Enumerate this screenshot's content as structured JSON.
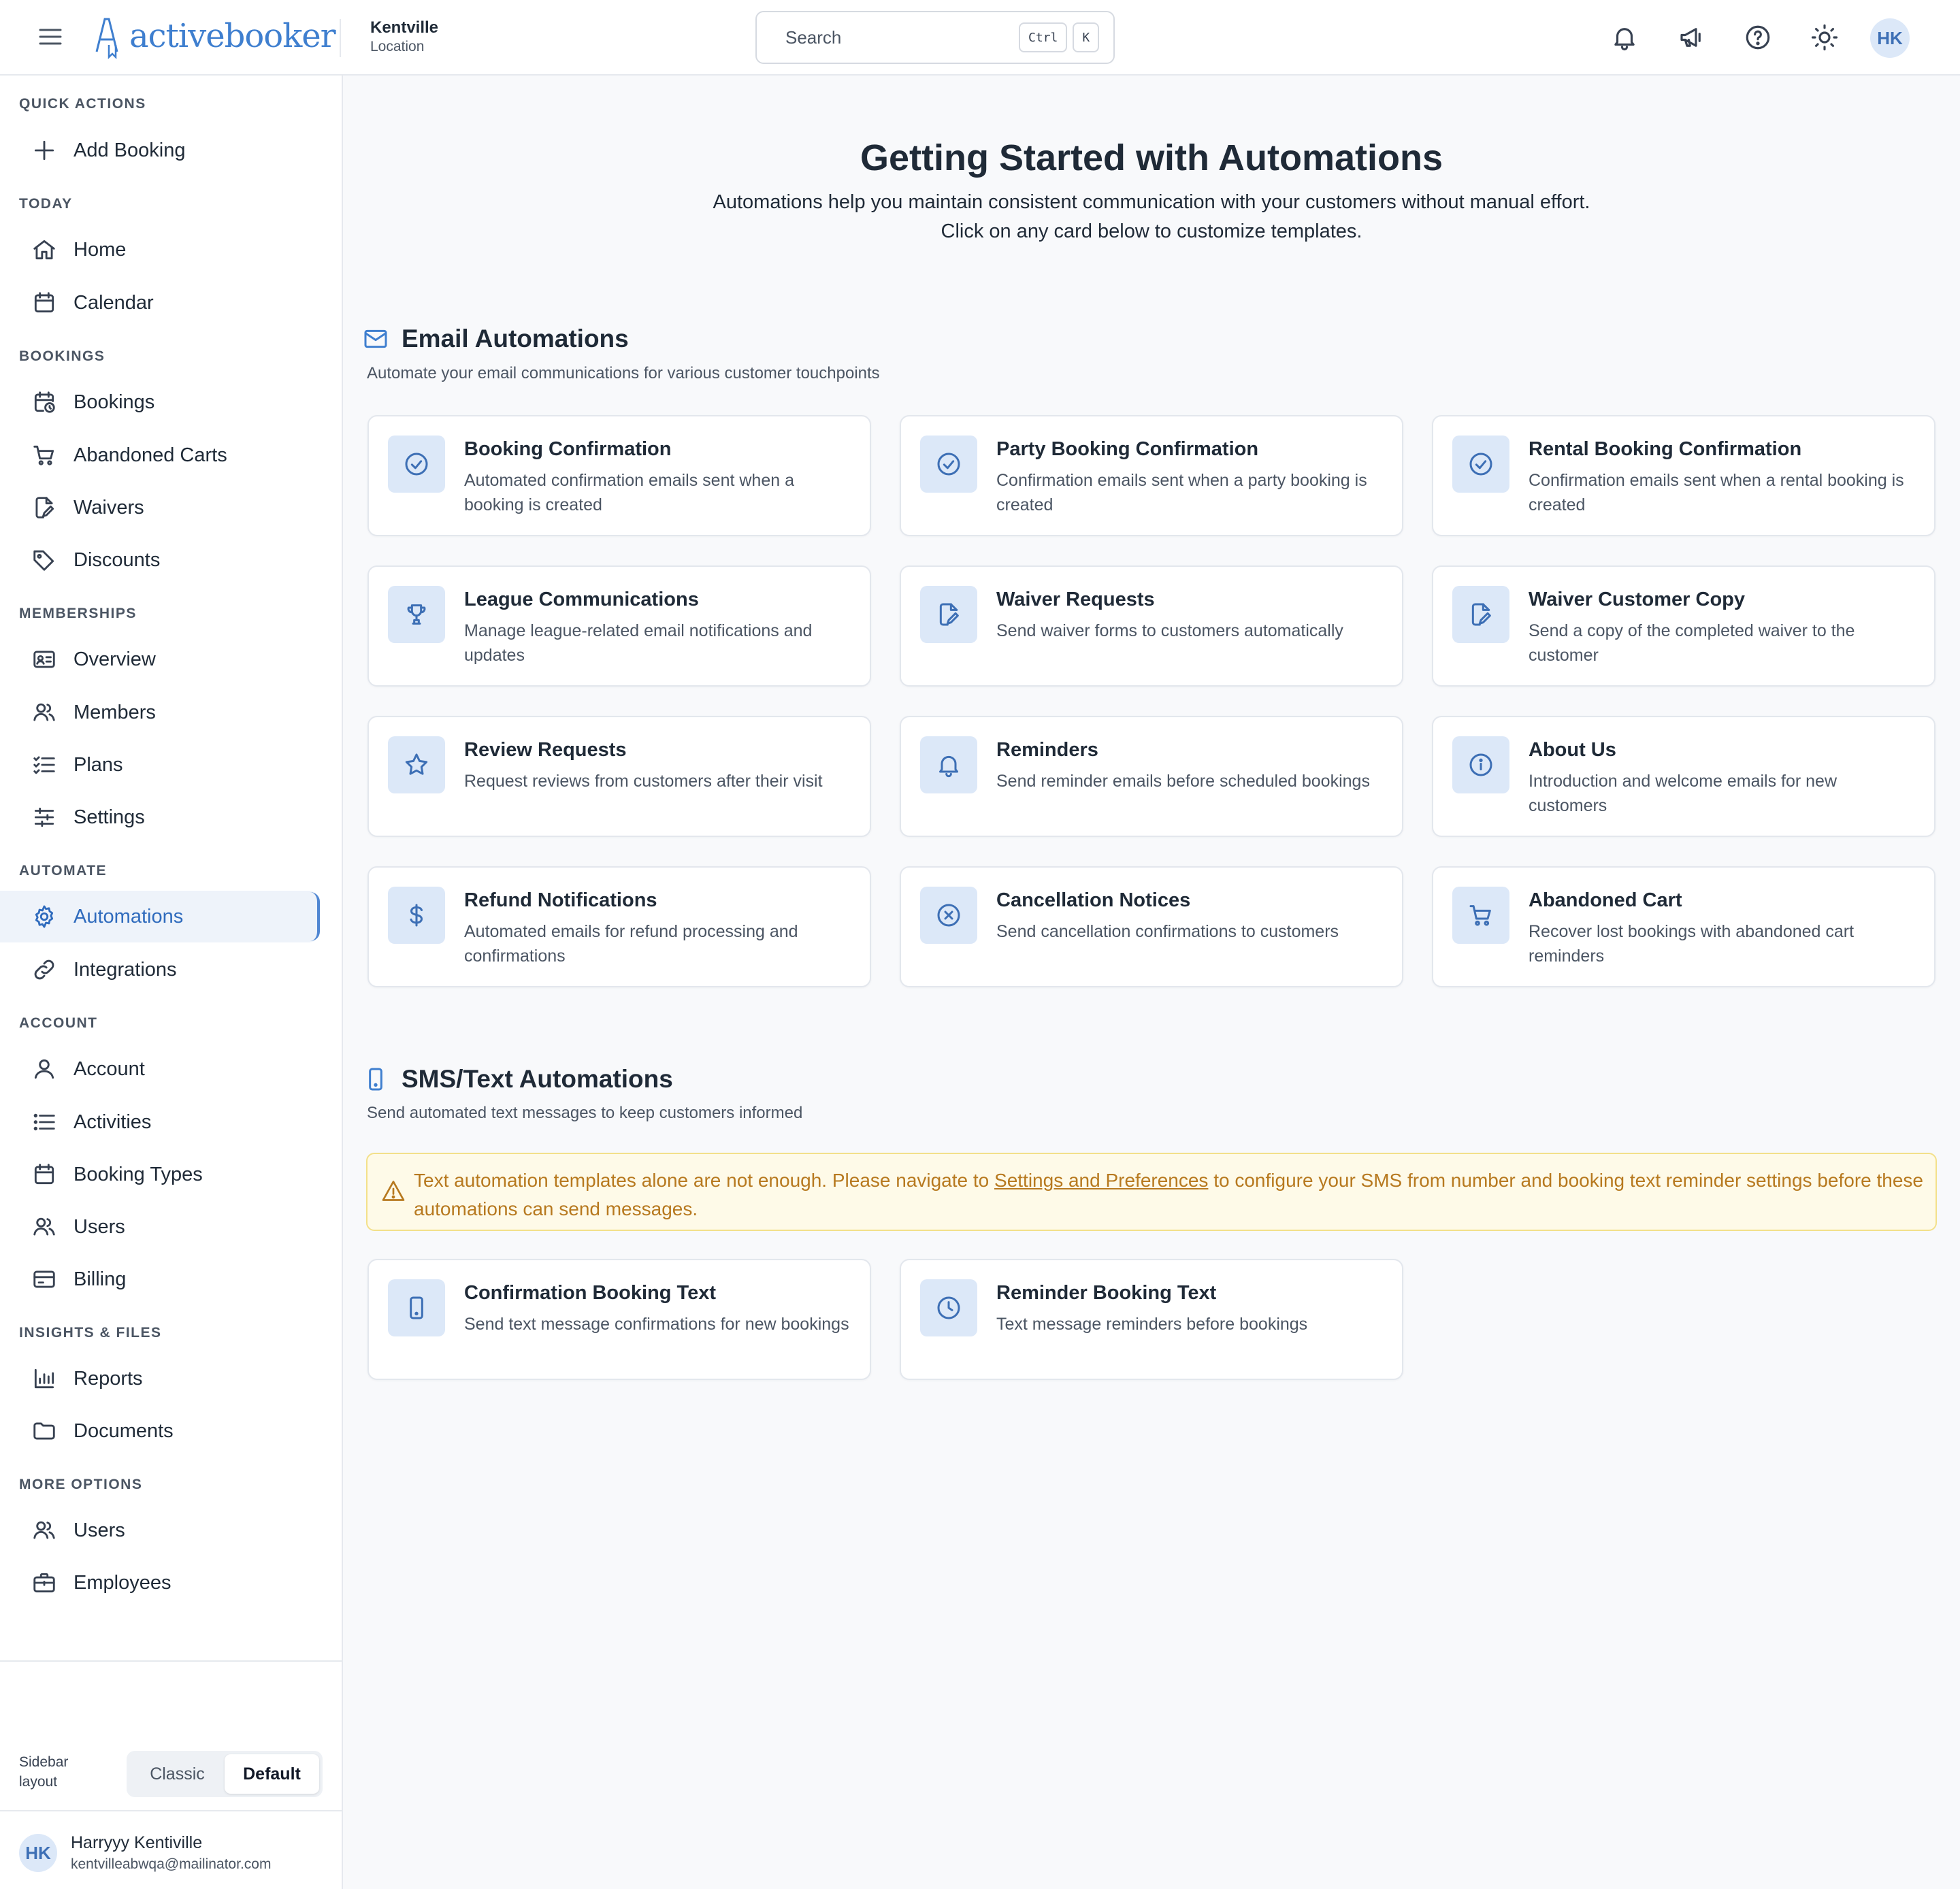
{
  "header": {
    "logo_text": "activebooker",
    "location_name": "Kentville",
    "location_label": "Location",
    "search_placeholder": "Search",
    "shortcut_key1": "Ctrl",
    "shortcut_key2": "K",
    "avatar_initials": "HK"
  },
  "sidebar": {
    "sections": {
      "quick_actions": "QUICK ACTIONS",
      "today": "TODAY",
      "bookings": "BOOKINGS",
      "memberships": "MEMBERSHIPS",
      "automate": "AUTOMATE",
      "account": "ACCOUNT",
      "insights": "INSIGHTS & FILES",
      "more": "MORE OPTIONS"
    },
    "items": {
      "add_booking": "Add Booking",
      "home": "Home",
      "calendar": "Calendar",
      "bookings": "Bookings",
      "abandoned_carts": "Abandoned Carts",
      "waivers": "Waivers",
      "discounts": "Discounts",
      "overview": "Overview",
      "members": "Members",
      "plans": "Plans",
      "settings": "Settings",
      "automations": "Automations",
      "integrations": "Integrations",
      "account": "Account",
      "activities": "Activities",
      "booking_types": "Booking Types",
      "users": "Users",
      "billing": "Billing",
      "reports": "Reports",
      "documents": "Documents",
      "users2": "Users",
      "employees": "Employees"
    },
    "layout": {
      "label": "Sidebar layout",
      "classic": "Classic",
      "default": "Default",
      "selected": "Default"
    },
    "user": {
      "initials": "HK",
      "name": "Harryyy Kentiville",
      "email": "kentvilleabwqa@mailinator.com"
    }
  },
  "main": {
    "title": "Getting Started with Automations",
    "subtitle_line1": "Automations help you maintain consistent communication with your customers without manual effort.",
    "subtitle_line2": "Click on any card below to customize templates.",
    "email": {
      "heading": "Email Automations",
      "description": "Automate your email communications for various customer touchpoints",
      "cards": [
        {
          "title": "Booking Confirmation",
          "desc": "Automated confirmation emails sent when a booking is created",
          "icon": "check-circle-icon"
        },
        {
          "title": "Party Booking Confirmation",
          "desc": "Confirmation emails sent when a party booking is created",
          "icon": "check-circle-icon"
        },
        {
          "title": "Rental Booking Confirmation",
          "desc": "Confirmation emails sent when a rental booking is created",
          "icon": "check-circle-icon"
        },
        {
          "title": "League Communications",
          "desc": "Manage league-related email notifications and updates",
          "icon": "trophy-icon"
        },
        {
          "title": "Waiver Requests",
          "desc": "Send waiver forms to customers automatically",
          "icon": "document-edit-icon"
        },
        {
          "title": "Waiver Customer Copy",
          "desc": "Send a copy of the completed waiver to the customer",
          "icon": "document-edit-icon"
        },
        {
          "title": "Review Requests",
          "desc": "Request reviews from customers after their visit",
          "icon": "star-icon"
        },
        {
          "title": "Reminders",
          "desc": "Send reminder emails before scheduled bookings",
          "icon": "bell-icon"
        },
        {
          "title": "About Us",
          "desc": "Introduction and welcome emails for new customers",
          "icon": "info-icon"
        },
        {
          "title": "Refund Notifications",
          "desc": "Automated emails for refund processing and confirmations",
          "icon": "dollar-icon"
        },
        {
          "title": "Cancellation Notices",
          "desc": "Send cancellation confirmations to customers",
          "icon": "x-circle-icon"
        },
        {
          "title": "Abandoned Cart",
          "desc": "Recover lost bookings with abandoned cart reminders",
          "icon": "cart-icon"
        }
      ]
    },
    "sms": {
      "heading": "SMS/Text Automations",
      "description": "Send automated text messages to keep customers informed",
      "warning_before": "Text automation templates alone are not enough. Please navigate to ",
      "warning_link": "Settings and Preferences",
      "warning_after": " to configure your SMS from number and booking text reminder settings before these automations can send messages.",
      "cards": [
        {
          "title": "Confirmation Booking Text",
          "desc": "Send text message confirmations for new bookings",
          "icon": "phone-icon"
        },
        {
          "title": "Reminder Booking Text",
          "desc": "Text message reminders before bookings",
          "icon": "clock-icon"
        }
      ]
    }
  },
  "colors": {
    "accent": "#3f7fcf",
    "icon_tile": "#dce8f8",
    "warning_bg": "#fefae8",
    "warning_text": "#b7791f"
  }
}
